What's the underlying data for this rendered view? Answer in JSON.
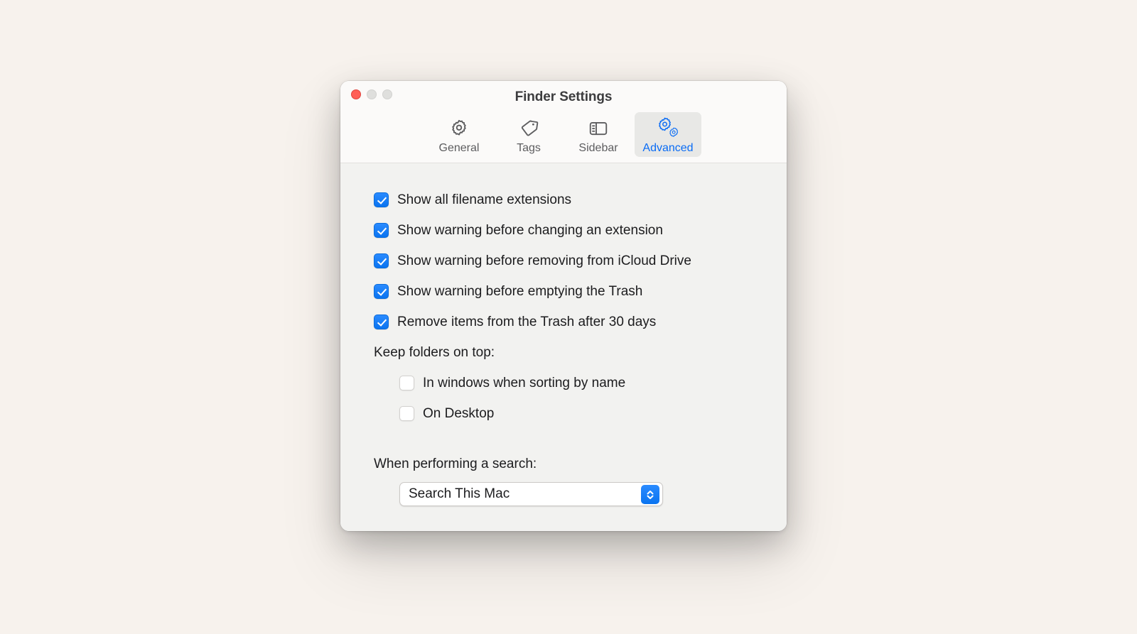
{
  "window": {
    "title": "Finder Settings",
    "traffic_lights": [
      {
        "name": "close",
        "color": "#ff5f57",
        "enabled": true
      },
      {
        "name": "minimize",
        "color": "#dfdfdd",
        "enabled": false
      },
      {
        "name": "zoom",
        "color": "#dfdfdd",
        "enabled": false
      }
    ]
  },
  "colors": {
    "accent_blue": "#0a74f0",
    "selected_tab_text": "#0a6cf5",
    "selected_tab_bg": "#e8e8e6",
    "page_background": "#f7f2ed",
    "content_background": "#f2f2f0",
    "toolbar_background": "#fbfaf9",
    "text": "#1c1c1e"
  },
  "toolbar": {
    "tabs": [
      {
        "label": "General",
        "icon": "gear-icon",
        "selected": false
      },
      {
        "label": "Tags",
        "icon": "tag-icon",
        "selected": false
      },
      {
        "label": "Sidebar",
        "icon": "sidebar-icon",
        "selected": false
      },
      {
        "label": "Advanced",
        "icon": "double-gear-icon",
        "selected": true
      }
    ]
  },
  "content": {
    "checkboxes": [
      {
        "label": "Show all filename extensions",
        "checked": true
      },
      {
        "label": "Show warning before changing an extension",
        "checked": true
      },
      {
        "label": "Show warning before removing from iCloud Drive",
        "checked": true
      },
      {
        "label": "Show warning before emptying the Trash",
        "checked": true
      },
      {
        "label": "Remove items from the Trash after 30 days",
        "checked": true
      }
    ],
    "keep_folders_group": {
      "label": "Keep folders on top:",
      "checkboxes": [
        {
          "label": "In windows when sorting by name",
          "checked": false
        },
        {
          "label": "On Desktop",
          "checked": false
        }
      ]
    },
    "search_group": {
      "label": "When performing a search:",
      "selected_option": "Search This Mac"
    }
  }
}
